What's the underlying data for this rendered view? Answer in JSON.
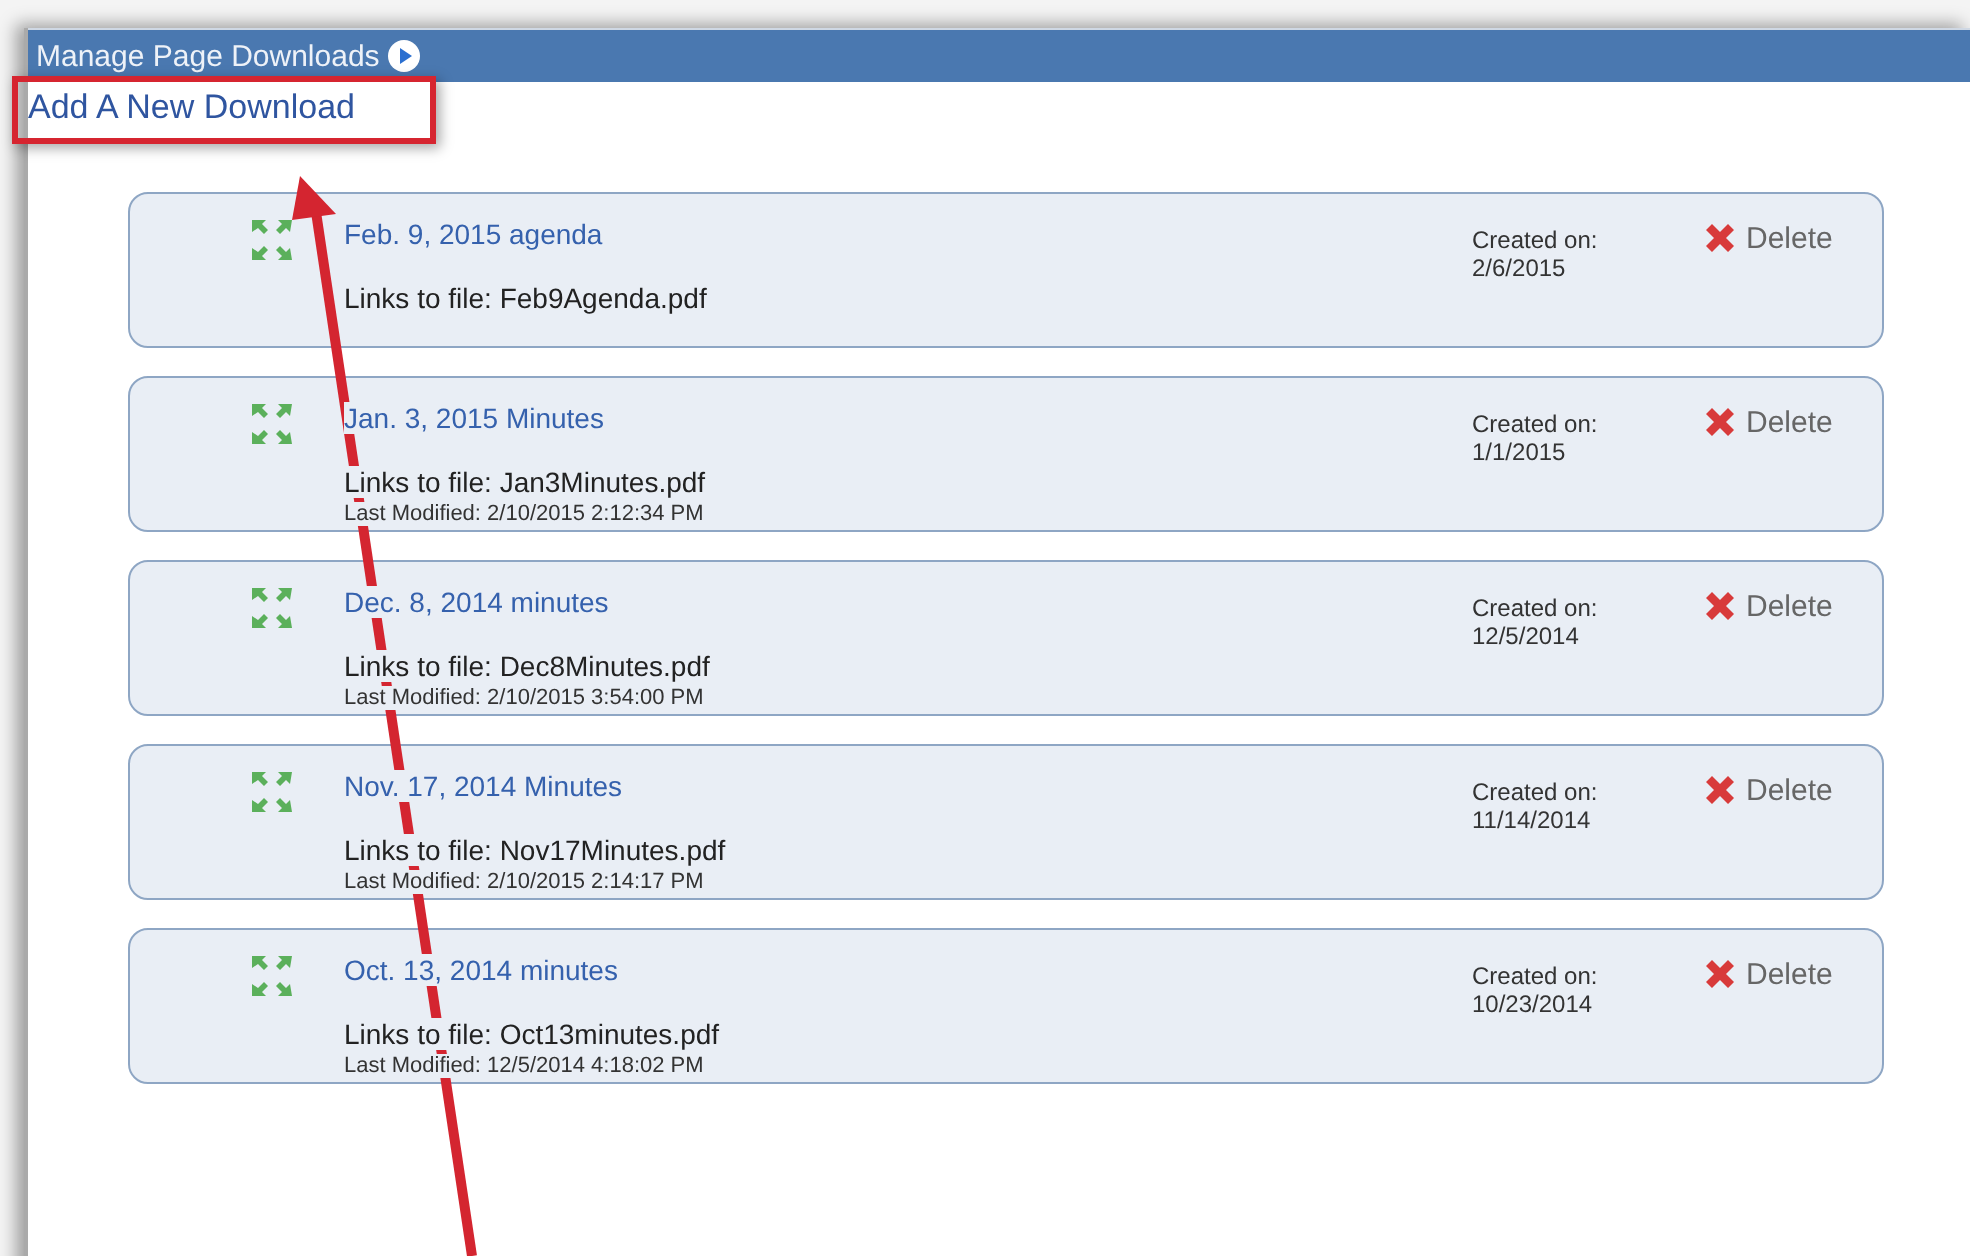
{
  "window": {
    "title": "Manage Page Downloads"
  },
  "add_link": "Add A New Download",
  "downloads": [
    {
      "title": "Feb. 9, 2015 agenda",
      "file": "Links to file: Feb9Agenda.pdf",
      "created_label": "Created on:",
      "created_date": "2/6/2015",
      "delete": "Delete"
    },
    {
      "title": "Jan. 3, 2015 Minutes",
      "file": "Links to file: Jan3Minutes.pdf",
      "modified": "Last Modified: 2/10/2015 2:12:34 PM",
      "created_label": "Created on:",
      "created_date": "1/1/2015",
      "delete": "Delete"
    },
    {
      "title": "Dec. 8, 2014 minutes",
      "file": "Links to file: Dec8Minutes.pdf",
      "modified": "Last Modified: 2/10/2015 3:54:00 PM",
      "created_label": "Created on:",
      "created_date": "12/5/2014",
      "delete": "Delete"
    },
    {
      "title": "Nov. 17, 2014 Minutes",
      "file": "Links to file: Nov17Minutes.pdf",
      "modified": "Last Modified: 2/10/2015 2:14:17 PM",
      "created_label": "Created on:",
      "created_date": "11/14/2014",
      "delete": "Delete"
    },
    {
      "title": "Oct. 13, 2014 minutes",
      "file": "Links to file: Oct13minutes.pdf",
      "modified": "Last Modified: 12/5/2014 4:18:02 PM",
      "created_label": "Created on:",
      "created_date": "10/23/2014",
      "delete": "Delete"
    }
  ]
}
